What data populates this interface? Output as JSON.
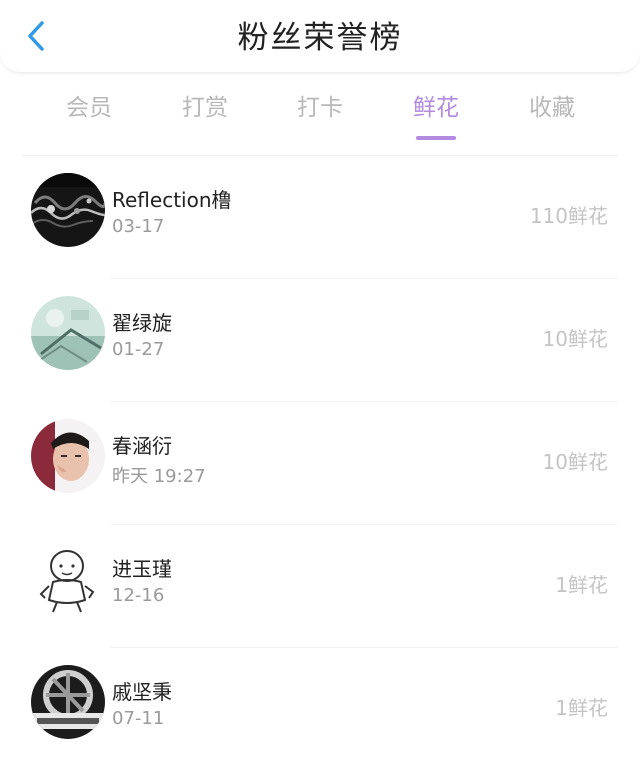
{
  "header": {
    "title": "粉丝荣誉榜",
    "back_icon": "chevron-left-icon",
    "accent_color": "#2e9ae8"
  },
  "tabs": [
    {
      "label": "会员",
      "active": false
    },
    {
      "label": "打赏",
      "active": false
    },
    {
      "label": "打卡",
      "active": false
    },
    {
      "label": "鲜花",
      "active": true
    },
    {
      "label": "收藏",
      "active": false
    }
  ],
  "active_tab_color": "#b28ae0",
  "list": [
    {
      "name": "Reflection橹",
      "date": "03-17",
      "count": "110鲜花",
      "avatar": "dark-pattern-avatar"
    },
    {
      "name": "翟绿旋",
      "date": "01-27",
      "count": "10鲜花",
      "avatar": "green-scene-avatar"
    },
    {
      "name": "春涵衍",
      "date": "昨天 19:27",
      "count": "10鲜花",
      "avatar": "person-photo-avatar"
    },
    {
      "name": "进玉瑾",
      "date": "12-16",
      "count": "1鲜花",
      "avatar": "baby-sketch-avatar"
    },
    {
      "name": "戚坚秉",
      "date": "07-11",
      "count": "1鲜花",
      "avatar": "wheel-photo-avatar"
    }
  ]
}
